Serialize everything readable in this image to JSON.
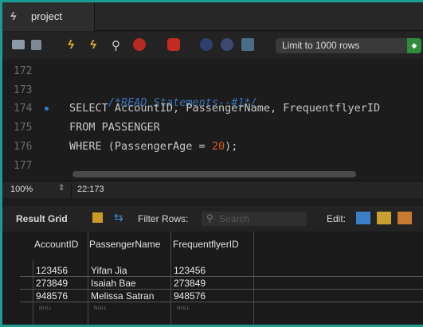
{
  "tab": {
    "title": "project"
  },
  "toolbar": {
    "limit_label": "Limit to 1000 rows"
  },
  "editor": {
    "line_numbers": [
      "172",
      "173",
      "174",
      "175",
      "176",
      "177"
    ],
    "lines": {
      "l173_comment": "/*READ Statements--#1*/",
      "l174_kw": "SELECT",
      "l174_rest": " AccountID, PassengerName, FrequentflyerID",
      "l175_kw": "FROM",
      "l175_rest": " PASSENGER",
      "l176_kw": "WHERE",
      "l176_rest": " (PassengerAge = ",
      "l176_num": "20",
      "l176_end": ");"
    }
  },
  "status": {
    "zoom": "100%",
    "position": "22:173"
  },
  "result": {
    "title": "Result Grid",
    "filter_label": "Filter Rows:",
    "search_placeholder": "Search",
    "edit_label": "Edit:",
    "columns": [
      "AccountID",
      "PassengerName",
      "FrequentflyerID"
    ],
    "rows": [
      [
        "123456",
        "Yifan Jia",
        "123456"
      ],
      [
        "273849",
        "Isaiah Bae",
        "273849"
      ],
      [
        "948576",
        "Melissa Satran",
        "948576"
      ],
      [
        "NULL",
        "NULL",
        "NULL"
      ]
    ]
  },
  "colors": {
    "accent_border": "#1a9c95",
    "comment": "#3b74b8",
    "number": "#d0582a",
    "limit_arrow": "#2e8b3a"
  },
  "icons": [
    "lightning-icon",
    "folder-icon",
    "save-icon",
    "execute-icon",
    "execute-cursor-icon",
    "explain-icon",
    "stop-icon",
    "toggle-icon",
    "commit-icon",
    "rollback-icon",
    "autocommit-icon",
    "grid-icon",
    "refresh-icon",
    "edit-icon",
    "add-row-icon",
    "delete-row-icon"
  ]
}
